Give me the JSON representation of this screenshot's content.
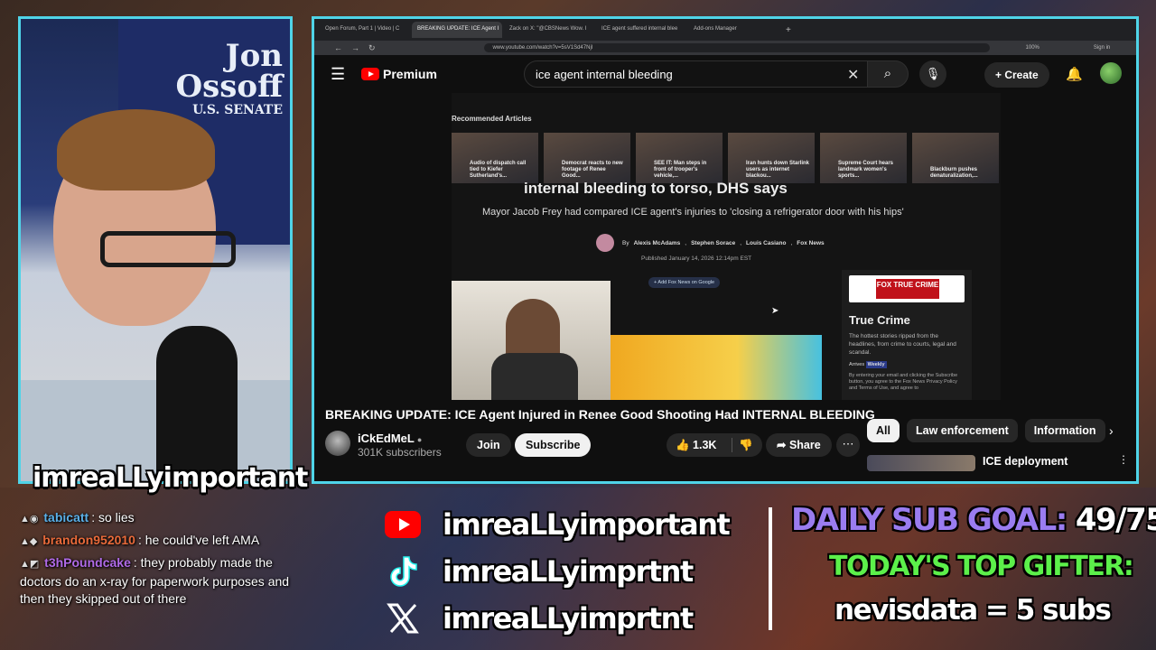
{
  "background": {
    "poster_text": [
      "Jon",
      "Ossoff",
      "U.S. SENATE"
    ]
  },
  "streamer": {
    "name": "imreaLLyimportant"
  },
  "chat": [
    {
      "user": "tabicatt",
      "color": "#5ab0e8",
      "message": "so lies"
    },
    {
      "user": "brandon952010",
      "color": "#e86a3a",
      "message": "he could've left AMA"
    },
    {
      "user": "t3hPoundcake",
      "color": "#b06ae8",
      "message": "they probably made the doctors do an x-ray for paperwork purposes and then they skipped out of there"
    }
  ],
  "browser": {
    "tabs": [
      {
        "label": "Open Forum, Part 1 | Video | C"
      },
      {
        "label": "BREAKING UPDATE: ICE Agent I"
      },
      {
        "label": "Zack on X: \"@CBSNews Wow. I"
      },
      {
        "label": "ICE agent suffered internal blee"
      },
      {
        "label": "Add-ons Manager"
      }
    ],
    "url": "www.youtube.com/watch?v=5sV1Sd47NjI",
    "zoom": "100%",
    "sign_in": "Sign in"
  },
  "youtube": {
    "logo": "Premium",
    "search_query": "ice agent internal bleeding",
    "create_label": "Create",
    "article": {
      "section": "Recommended Articles",
      "thumbs": [
        "Audio of dispatch call tied to Kiefer Sutherland's...",
        "Democrat reacts to new footage of Renee Good...",
        "SEE IT: Man steps in front of trooper's vehicle,...",
        "Iran hunts down Starlink users as internet blackou...",
        "Supreme Court hears landmark women's sports...",
        "Blackburn pushes denaturalization,..."
      ],
      "headline": "internal bleeding to torso, DHS says",
      "subheadline": "Mayor Jacob Frey had compared ICE agent's injuries to 'closing a refrigerator door with his hips'",
      "by": "By",
      "authors": [
        "Alexis McAdams",
        "Stephen Sorace",
        "Louis Casiano",
        "Fox News"
      ],
      "published": "Published January 14, 2026 12:14pm EST",
      "follow_label": "+ Add Fox News on Google",
      "true_crime": {
        "logo": "FOX TRUE CRIME",
        "title": "True Crime",
        "description": "The hottest stories ripped from the headlines, from crime to courts, legal and scandal.",
        "tag_label": "Arrives",
        "tag_value": "Weekly",
        "legal": "By entering your email and clicking the Subscribe button, you agree to the Fox News Privacy Policy and Terms of Use, and agree to"
      }
    },
    "video_title": "BREAKING UPDATE: ICE Agent Injured in Renee Good Shooting Had INTERNAL BLEEDING",
    "channel": {
      "name": "iCkEdMeL",
      "subscribers": "301K subscribers"
    },
    "join_label": "Join",
    "subscribe_label": "Subscribe",
    "likes": "1.3K",
    "share_label": "Share",
    "chips": [
      "All",
      "Law enforcement",
      "Information"
    ],
    "side_item_title": "ICE deployment"
  },
  "socials": [
    {
      "platform": "youtube-icon",
      "handle": "imreaLLyimportant"
    },
    {
      "platform": "tiktok-icon",
      "handle": "imreaLLyimprtnt"
    },
    {
      "platform": "x-icon",
      "handle": "imreaLLyimprtnt"
    }
  ],
  "goal": {
    "label": "DAILY SUB GOAL:",
    "value": "49/75"
  },
  "gifter": {
    "label": "TODAY'S TOP GIFTER:",
    "value": "nevisdata = 5 subs"
  }
}
